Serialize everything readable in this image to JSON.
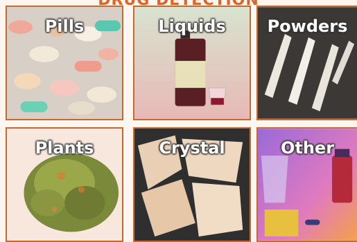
{
  "header": {
    "title": "DRUG DETECTION"
  },
  "tiles": [
    {
      "label": "Pills"
    },
    {
      "label": "Liquids"
    },
    {
      "label": "Powders"
    },
    {
      "label": "Plants"
    },
    {
      "label": "Crystal"
    },
    {
      "label": "Other"
    }
  ],
  "colors": {
    "accent": "#d9662b",
    "border": "#c9682a",
    "background": "#fdf6f0"
  }
}
